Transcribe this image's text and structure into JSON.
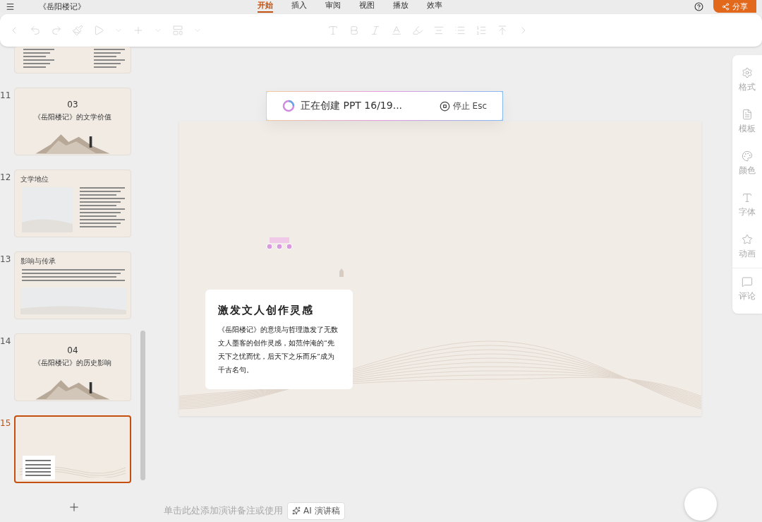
{
  "document": {
    "title": "《岳阳楼记》"
  },
  "menu_tabs": [
    {
      "label": "开始",
      "selected": true
    },
    {
      "label": "插入",
      "selected": false
    },
    {
      "label": "审阅",
      "selected": false
    },
    {
      "label": "视图",
      "selected": false
    },
    {
      "label": "播放",
      "selected": false
    },
    {
      "label": "效率",
      "selected": false
    }
  ],
  "share_button": "分享",
  "slides": [
    {
      "kind": "columns",
      "selected": false
    },
    {
      "number": "11",
      "kind": "section",
      "index": "03",
      "title": "《岳阳楼记》的文学价值",
      "selected": false
    },
    {
      "number": "12",
      "kind": "content",
      "heading": "文学地位",
      "selected": false
    },
    {
      "number": "13",
      "kind": "grid",
      "heading": "影响与传承",
      "selected": false
    },
    {
      "number": "14",
      "kind": "section",
      "index": "04",
      "title": "《岳阳楼记》的历史影响",
      "selected": false
    },
    {
      "number": "15",
      "kind": "current",
      "selected": true
    }
  ],
  "progress": {
    "text": "正在创建 PPT 16/19...",
    "stop": "停止 Esc"
  },
  "slide": {
    "title": "激发文人创作灵感",
    "body": "《岳阳楼记》的意境与哲理激发了无数文人墨客的创作灵感，如范仲淹的“先天下之忧而忧，后天下之乐而乐”成为千古名句。"
  },
  "side_panel": [
    {
      "label": "格式",
      "kind": "settings"
    },
    {
      "label": "模板",
      "kind": "template"
    },
    {
      "label": "颜色",
      "kind": "palette"
    },
    {
      "label": "字体",
      "kind": "font"
    },
    {
      "label": "动画",
      "kind": "animation"
    },
    {
      "label": "评论",
      "kind": "comment"
    }
  ],
  "notes": {
    "placeholder": "单击此处添加演讲备注或使用",
    "ai_button": "AI 演讲稿"
  }
}
